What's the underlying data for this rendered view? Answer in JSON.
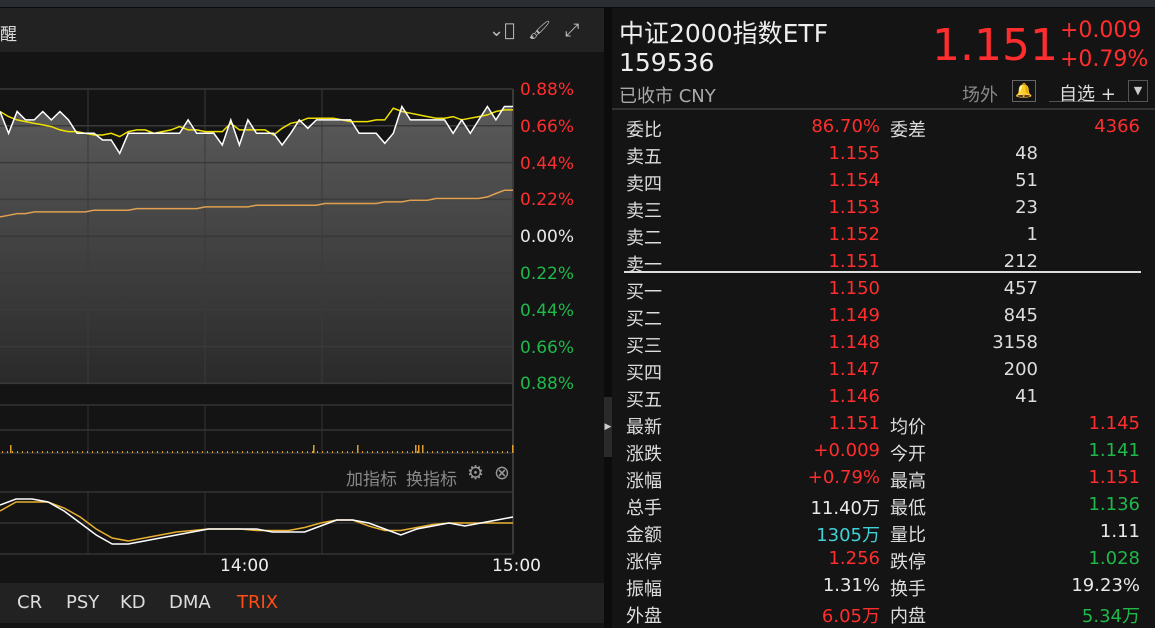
{
  "chart_header": {
    "title_partial": "醒",
    "icons": [
      "chevron-down-circle-icon",
      "brush-icon",
      "fullscreen-icon"
    ]
  },
  "price_axis": [
    {
      "label": "0.88%",
      "color": "#ff2d2d"
    },
    {
      "label": "0.66%",
      "color": "#ff2d2d"
    },
    {
      "label": "0.44%",
      "color": "#ff2d2d"
    },
    {
      "label": "0.22%",
      "color": "#ff2d2d"
    },
    {
      "label": "0.00%",
      "color": "#e8e8e8"
    },
    {
      "label": "0.22%",
      "color": "#1fb84a"
    },
    {
      "label": "0.44%",
      "color": "#1fb84a"
    },
    {
      "label": "0.66%",
      "color": "#1fb84a"
    },
    {
      "label": "0.88%",
      "color": "#1fb84a"
    }
  ],
  "chart_data": {
    "type": "line",
    "price_pct": [
      0.75,
      0.62,
      0.75,
      0.7,
      0.7,
      0.75,
      0.7,
      0.75,
      0.7,
      0.62,
      0.62,
      0.62,
      0.58,
      0.58,
      0.5,
      0.62,
      0.62,
      0.62,
      0.62,
      0.62,
      0.62,
      0.62,
      0.7,
      0.62,
      0.62,
      0.62,
      0.55,
      0.7,
      0.55,
      0.7,
      0.62,
      0.62,
      0.62,
      0.55,
      0.62,
      0.7,
      0.65,
      0.7,
      0.7,
      0.7,
      0.7,
      0.7,
      0.62,
      0.62,
      0.62,
      0.56,
      0.62,
      0.78,
      0.7,
      0.7,
      0.7,
      0.7,
      0.7,
      0.62,
      0.7,
      0.62,
      0.7,
      0.78,
      0.7,
      0.78,
      0.78
    ],
    "avg_pct": [
      0.75,
      0.72,
      0.7,
      0.69,
      0.68,
      0.67,
      0.66,
      0.64,
      0.63,
      0.63,
      0.62,
      0.61,
      0.61,
      0.62,
      0.6,
      0.63,
      0.64,
      0.64,
      0.62,
      0.63,
      0.64,
      0.66,
      0.64,
      0.64,
      0.63,
      0.63,
      0.63,
      0.68,
      0.64,
      0.64,
      0.64,
      0.64,
      0.61,
      0.65,
      0.68,
      0.69,
      0.71,
      0.71,
      0.71,
      0.71,
      0.7,
      0.69,
      0.69,
      0.69,
      0.7,
      0.7,
      0.77,
      0.75,
      0.74,
      0.73,
      0.72,
      0.71,
      0.71,
      0.72,
      0.7,
      0.71,
      0.72,
      0.73,
      0.75,
      0.76,
      0.76
    ],
    "bench_pct": [
      0.12,
      0.13,
      0.14,
      0.14,
      0.15,
      0.15,
      0.15,
      0.15,
      0.15,
      0.15,
      0.15,
      0.16,
      0.16,
      0.16,
      0.16,
      0.16,
      0.17,
      0.17,
      0.17,
      0.17,
      0.17,
      0.17,
      0.17,
      0.17,
      0.18,
      0.18,
      0.18,
      0.18,
      0.18,
      0.18,
      0.19,
      0.19,
      0.19,
      0.19,
      0.19,
      0.19,
      0.19,
      0.19,
      0.2,
      0.2,
      0.2,
      0.2,
      0.2,
      0.2,
      0.2,
      0.21,
      0.21,
      0.21,
      0.22,
      0.22,
      0.22,
      0.23,
      0.23,
      0.23,
      0.23,
      0.23,
      0.23,
      0.24,
      0.26,
      0.28,
      0.28
    ],
    "trix_a": [
      0.6,
      0.8,
      0.8,
      0.7,
      0.4,
      0.0,
      -0.4,
      -0.7,
      -0.7,
      -0.6,
      -0.5,
      -0.4,
      -0.3,
      -0.2,
      -0.2,
      -0.2,
      -0.2,
      -0.3,
      -0.3,
      -0.3,
      -0.1,
      0.1,
      0.1,
      0.0,
      -0.2,
      -0.4,
      -0.2,
      -0.1,
      0.0,
      -0.1,
      0.0,
      0.1,
      0.2
    ],
    "trix_b": [
      0.4,
      0.7,
      0.7,
      0.7,
      0.5,
      0.2,
      -0.2,
      -0.5,
      -0.6,
      -0.5,
      -0.4,
      -0.3,
      -0.25,
      -0.2,
      -0.2,
      -0.2,
      -0.25,
      -0.25,
      -0.25,
      -0.15,
      0.0,
      0.1,
      0.1,
      -0.1,
      -0.25,
      -0.25,
      -0.15,
      -0.05,
      0.0,
      0.0,
      0.0,
      0.0,
      0.0
    ],
    "x_ticks": [
      "14:00",
      "15:00"
    ]
  },
  "indicator_bar": {
    "add": "加指标",
    "switch": "换指标"
  },
  "tabs": [
    {
      "label": "CR",
      "active": false
    },
    {
      "label": "PSY",
      "active": false
    },
    {
      "label": "KD",
      "active": false
    },
    {
      "label": "DMA",
      "active": false
    },
    {
      "label": "TRIX",
      "active": true
    }
  ],
  "quote": {
    "name": "中证2000指数ETF",
    "code": "159536",
    "status": "已收市 CNY",
    "price": "1.151",
    "change": "+0.009",
    "change_pct": "+0.79%",
    "market": "场外",
    "watch": "自选 +"
  },
  "orderbook": {
    "ratio_label": "委比",
    "ratio": "86.70%",
    "diff_label": "委差",
    "diff": "4366",
    "asks": [
      {
        "label": "卖五",
        "price": "1.155",
        "vol": "48"
      },
      {
        "label": "卖四",
        "price": "1.154",
        "vol": "51"
      },
      {
        "label": "卖三",
        "price": "1.153",
        "vol": "23"
      },
      {
        "label": "卖二",
        "price": "1.152",
        "vol": "1"
      },
      {
        "label": "卖一",
        "price": "1.151",
        "vol": "212"
      }
    ],
    "bids": [
      {
        "label": "买一",
        "price": "1.150",
        "vol": "457"
      },
      {
        "label": "买二",
        "price": "1.149",
        "vol": "845"
      },
      {
        "label": "买三",
        "price": "1.148",
        "vol": "3158"
      },
      {
        "label": "买四",
        "price": "1.147",
        "vol": "200"
      },
      {
        "label": "买五",
        "price": "1.146",
        "vol": "41"
      }
    ]
  },
  "stats": [
    {
      "l1": "最新",
      "v1": "1.151",
      "c1": "red",
      "l2": "均价",
      "v2": "1.145",
      "c2": "red"
    },
    {
      "l1": "涨跌",
      "v1": "+0.009",
      "c1": "red",
      "l2": "今开",
      "v2": "1.141",
      "c2": "grn"
    },
    {
      "l1": "涨幅",
      "v1": "+0.79%",
      "c1": "red",
      "l2": "最高",
      "v2": "1.151",
      "c2": "red"
    },
    {
      "l1": "总手",
      "v1": "11.40万",
      "c1": "wht",
      "l2": "最低",
      "v2": "1.136",
      "c2": "grn"
    },
    {
      "l1": "金额",
      "v1": "1305万",
      "c1": "cyan",
      "l2": "量比",
      "v2": "1.11",
      "c2": "wht"
    },
    {
      "l1": "涨停",
      "v1": "1.256",
      "c1": "red",
      "l2": "跌停",
      "v2": "1.028",
      "c2": "grn"
    },
    {
      "l1": "振幅",
      "v1": "1.31%",
      "c1": "wht",
      "l2": "换手",
      "v2": "19.23%",
      "c2": "wht"
    },
    {
      "l1": "外盘",
      "v1": "6.05万",
      "c1": "red",
      "l2": "内盘",
      "v2": "5.34万",
      "c2": "grn"
    }
  ]
}
